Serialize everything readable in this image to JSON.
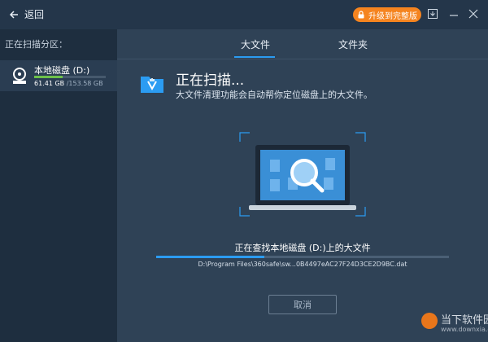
{
  "window": {
    "back_label": "返回",
    "upgrade_label": "升级到完整版",
    "accent_color": "#2b9cf2",
    "upgrade_color": "#f5841f"
  },
  "sidebar": {
    "title": "正在扫描分区：",
    "drive": {
      "name": "本地磁盘 (D:)",
      "used": "61.41 GB",
      "total": "/153.58 GB",
      "usage_fraction": 0.4
    }
  },
  "tabs": [
    {
      "label": "大文件",
      "active": true
    },
    {
      "label": "文件夹",
      "active": false
    }
  ],
  "scan": {
    "heading": "正在扫描...",
    "description": "大文件清理功能会自动帮你定位磁盘上的大文件。",
    "status": "正在查找本地磁盘 (D:)上的大文件",
    "progress_fraction": 0.37,
    "current_path": "D:\\Program Files\\360safe\\sw...0B4497eAC27F24D3CE2D9BC.dat",
    "cancel_label": "取消"
  },
  "watermark": {
    "text": "当下软件园",
    "url": "www.downxia.com"
  }
}
